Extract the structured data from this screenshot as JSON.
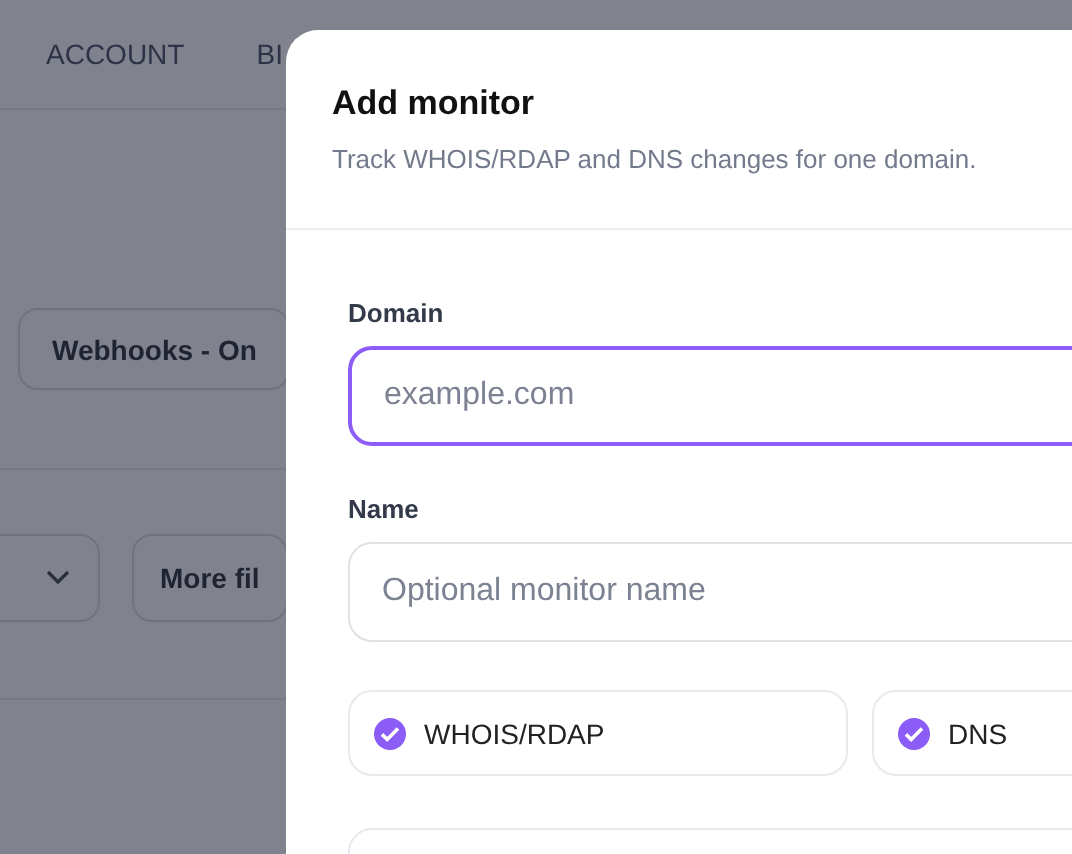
{
  "background": {
    "nav_tabs": [
      "ACCOUNT",
      "BI"
    ],
    "webhooks_button": "Webhooks - On",
    "more_filters_button": "More fil"
  },
  "modal": {
    "title": "Add monitor",
    "subtitle": "Track WHOIS/RDAP and DNS changes for one domain.",
    "fields": [
      {
        "label": "Domain",
        "placeholder": "example.com",
        "focused": true
      },
      {
        "label": "Name",
        "placeholder": "Optional monitor name",
        "focused": false
      }
    ],
    "checks": [
      {
        "label": "WHOIS/RDAP",
        "checked": true
      },
      {
        "label": "DNS",
        "checked": true
      }
    ]
  }
}
